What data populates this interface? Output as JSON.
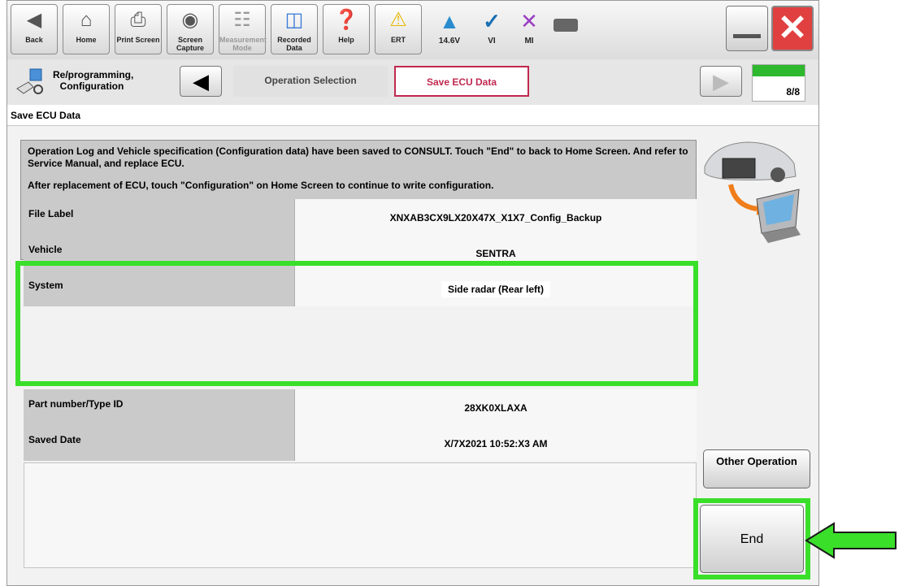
{
  "toolbar": {
    "buttons": [
      {
        "label": "Back",
        "icon": "back-arrow-icon"
      },
      {
        "label": "Home",
        "icon": "home-icon"
      },
      {
        "label": "Print Screen",
        "icon": "printer-icon"
      },
      {
        "label": "Screen Capture",
        "icon": "camera-icon"
      },
      {
        "label": "Measurement Mode",
        "icon": "measurement-icon"
      },
      {
        "label": "Recorded Data",
        "icon": "recorded-data-icon"
      },
      {
        "label": "Help",
        "icon": "help-icon"
      },
      {
        "label": "ERT",
        "icon": "warning-icon"
      }
    ],
    "status": [
      {
        "label": "14.6V",
        "icon": "car-battery-icon"
      },
      {
        "label": "VI",
        "icon": "signal-icon"
      },
      {
        "label": "MI",
        "icon": "mi-x-icon"
      }
    ]
  },
  "breadcrumb": {
    "mode_label": "Re/programming, Configuration",
    "steps": [
      "Operation Selection",
      "Save ECU Data"
    ],
    "page": "8/8",
    "progress": 1.0
  },
  "section_title": "Save ECU Data",
  "message": {
    "paragraph1": "Operation Log and Vehicle specification (Configuration data) have been saved to CONSULT. Touch \"End\" to back to Home Screen. And refer to Service Manual, and replace ECU.",
    "paragraph2": "After replacement of ECU, touch \"Configuration\" on Home Screen to continue to write configuration."
  },
  "table": [
    {
      "key": "File Label",
      "value": "XNXAB3CX9LX20X47X_X1X7_Config_Backup"
    },
    {
      "key": "Vehicle",
      "value": "SENTRA"
    },
    {
      "key": "System",
      "value": "Side radar (Rear left)"
    },
    {
      "key": "Part number/Type ID",
      "value": "28XK0XLAXA"
    },
    {
      "key": "Saved Date",
      "value": "X/7X2021 10:52:X3 AM"
    }
  ],
  "buttons": {
    "other_operation": "Other Operation",
    "end": "End"
  },
  "colors": {
    "highlight": "#3adf2a",
    "close_red": "#e04040",
    "progress_green": "#2eb82e"
  }
}
